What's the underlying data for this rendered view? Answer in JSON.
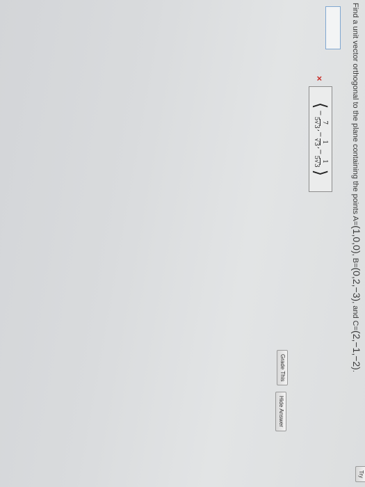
{
  "question": {
    "prefix": "Find a unit vector orthogonal to the plane containing the points",
    "pointA_label": "A=",
    "pointA": "(1,0,0)",
    "pointB_label": ", B=",
    "pointB": "(0,2,−3)",
    "pointC_label": ", and C=",
    "pointC": "(2,−1,−2)",
    "end": "."
  },
  "answer": {
    "input_value": "",
    "wrong_mark": "×",
    "solution": {
      "open": "⟨",
      "t1_sign": "−",
      "t1_num": "7",
      "t1_den": "5√3",
      "sep1": ",",
      "t2_sign": "−",
      "t2_num": "1",
      "t2_den": "√3",
      "sep2": ",",
      "t3_sign": "−",
      "t3_num": "1",
      "t3_den": "5√3",
      "close": "⟩"
    }
  },
  "buttons": {
    "grade": "Grade This",
    "hide": "Hide Answer",
    "try": "Try"
  }
}
